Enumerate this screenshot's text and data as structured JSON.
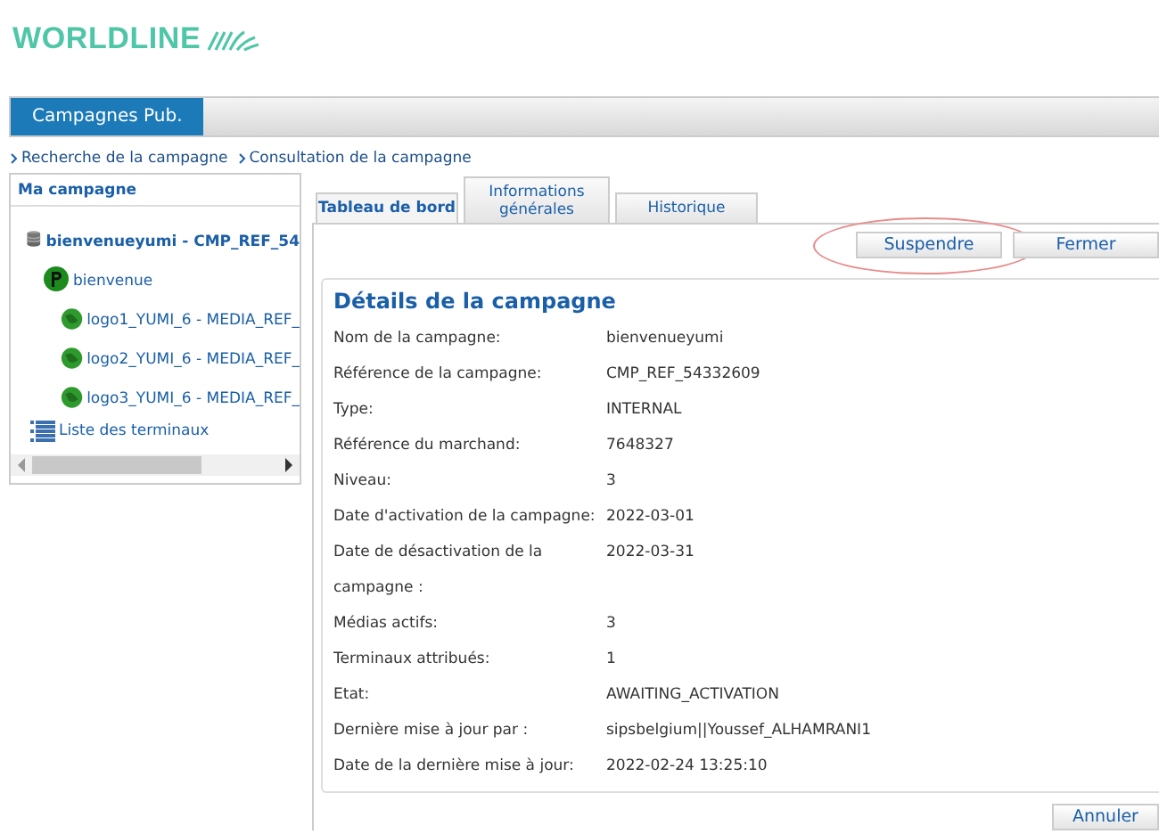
{
  "logo": {
    "text": "WORLDLINE"
  },
  "nav": {
    "tabs": [
      {
        "label": "Campagnes Pub.",
        "selected": true
      }
    ]
  },
  "breadcrumb": [
    {
      "label": "Recherche de la campagne"
    },
    {
      "label": "Consultation de la campagne"
    }
  ],
  "sidebar": {
    "title": "Ma campagne",
    "tree": [
      {
        "kind": "campaign",
        "label": "bienvenueyumi - CMP_REF_54",
        "children": [
          {
            "kind": "playlist",
            "label": "bienvenue",
            "children": [
              {
                "kind": "media",
                "label": "logo1_YUMI_6 - MEDIA_REF_"
              },
              {
                "kind": "media",
                "label": "logo2_YUMI_6 - MEDIA_REF_"
              },
              {
                "kind": "media",
                "label": "logo3_YUMI_6 - MEDIA_REF_"
              }
            ]
          },
          {
            "kind": "terminals",
            "label": "Liste des terminaux"
          }
        ]
      }
    ]
  },
  "tabs": [
    {
      "label": "Tableau de bord",
      "selected": true
    },
    {
      "label": "Informations générales",
      "selected": false
    },
    {
      "label": "Historique",
      "selected": false
    }
  ],
  "actions": [
    {
      "label": "Suspendre",
      "circled": true
    },
    {
      "label": "Fermer",
      "circled": false
    }
  ],
  "details": {
    "title": "Détails de la campagne",
    "rows": [
      {
        "label": "Nom de la campagne:",
        "value": "bienvenueyumi"
      },
      {
        "label": "Référence de la campagne:",
        "value": "CMP_REF_54332609"
      },
      {
        "label": "Type:",
        "value": "INTERNAL"
      },
      {
        "label": "Référence du marchand:",
        "value": "7648327"
      },
      {
        "label": "Niveau:",
        "value": "3"
      },
      {
        "label": "Date d'activation de la campagne:",
        "value": "2022-03-01"
      },
      {
        "label": "Date de désactivation de la campagne :",
        "value": "2022-03-31"
      },
      {
        "label": "Médias actifs:",
        "value": "3"
      },
      {
        "label": "Terminaux attribués:",
        "value": "1"
      },
      {
        "label": "Etat:",
        "value": "AWAITING_ACTIVATION"
      },
      {
        "label": "Dernière mise à jour par :",
        "value": "sipsbelgium||Youssef_ALHAMRANI1"
      },
      {
        "label": "Date de la dernière mise à jour:",
        "value": "2022-02-24 13:25:10"
      }
    ]
  },
  "footer_button": "Annuler"
}
